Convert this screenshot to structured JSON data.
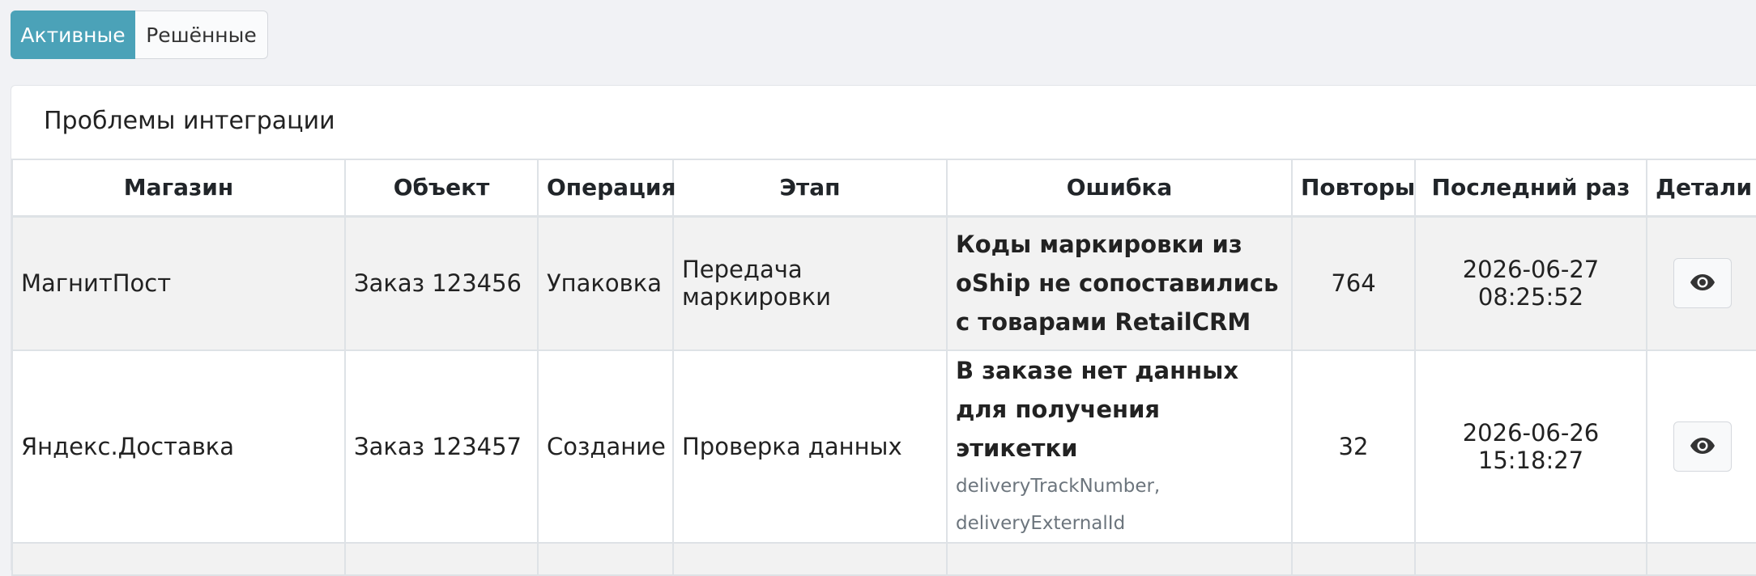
{
  "tabs": {
    "active": "Активные",
    "resolved": "Решённые"
  },
  "card": {
    "title": "Проблемы интеграции"
  },
  "table": {
    "headers": [
      "Магазин",
      "Объект",
      "Операция",
      "Этап",
      "Ошибка",
      "Повторы",
      "Последний раз",
      "Детали"
    ],
    "rows": [
      {
        "shop": "МагнитПост",
        "object": "Заказ 123456",
        "operation": "Упаковка",
        "stage": "Передача маркировки",
        "error": "Коды маркировки из oShip не сопоставились с товарами RetailCRM",
        "error_detail": "",
        "retries": "764",
        "last": "2026-06-27 08:25:52"
      },
      {
        "shop": "Яндекс.Доставка",
        "object": "Заказ 123457",
        "operation": "Создание",
        "stage": "Проверка данных",
        "error": "В заказе нет данных для получения этикетки",
        "error_detail": "deliveryTrackNumber, deliveryExternalId",
        "retries": "32",
        "last": "2026-06-26 15:18:27"
      }
    ]
  },
  "icons": {
    "details": "eye-icon"
  },
  "colors": {
    "accent": "#4ba2b8",
    "stripe": "#f2f2f2"
  }
}
